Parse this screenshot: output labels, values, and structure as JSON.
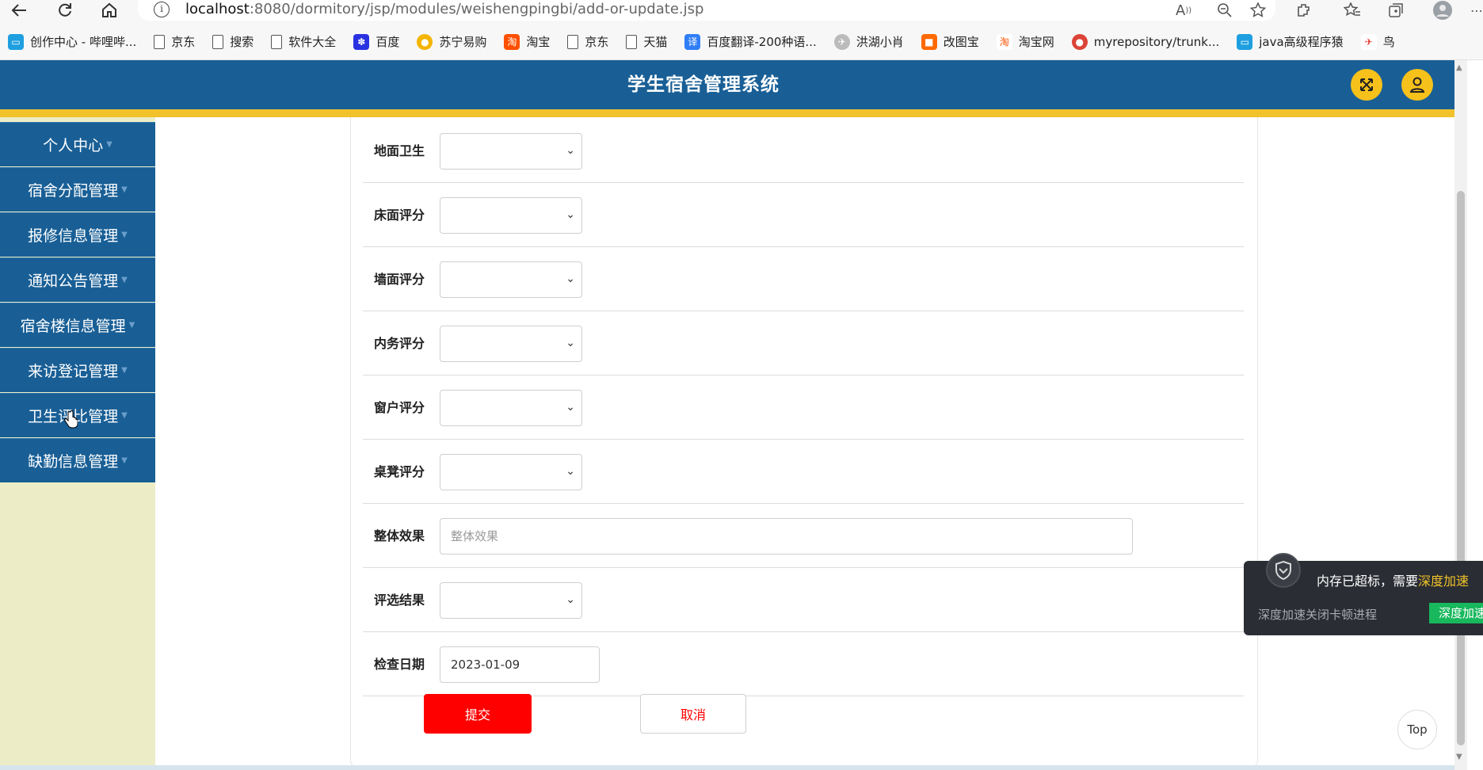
{
  "browser": {
    "url_host": "localhost",
    "url_path": ":8080/dormitory/jsp/modules/weishengpingbi/add-or-update.jsp",
    "bookmarks": [
      {
        "label": "创作中心 - 哔哩哔...",
        "icon": "bilibili-icon",
        "color": "#1e9fe0"
      },
      {
        "label": "京东",
        "icon": "page-icon"
      },
      {
        "label": "搜索",
        "icon": "page-icon"
      },
      {
        "label": "软件大全",
        "icon": "page-icon"
      },
      {
        "label": "百度",
        "icon": "baidu-icon",
        "color": "#2932e1"
      },
      {
        "label": "苏宁易购",
        "icon": "suning-icon",
        "color": "#f4b400"
      },
      {
        "label": "淘宝",
        "icon": "taobao-icon",
        "color": "#ff5000"
      },
      {
        "label": "京东",
        "icon": "page-icon"
      },
      {
        "label": "天猫",
        "icon": "page-icon"
      },
      {
        "label": "百度翻译-200种语...",
        "icon": "baidu-translate-icon",
        "color": "#2f7ef7"
      },
      {
        "label": "洪湖小肖",
        "icon": "bird-icon",
        "color": "#666666"
      },
      {
        "label": "改图宝",
        "icon": "gaitubao-icon",
        "color": "#ff6a00"
      },
      {
        "label": "淘宝网",
        "icon": "taobao-net-icon",
        "color": "#ff5000"
      },
      {
        "label": "myrepository/trunk...",
        "icon": "chrome-icon",
        "color": "#db4437"
      },
      {
        "label": "java高级程序猿",
        "icon": "bilibili-icon",
        "color": "#1e9fe0"
      },
      {
        "label": "鸟",
        "icon": "bird-red-icon",
        "color": "#e53935"
      }
    ]
  },
  "app": {
    "title": "学生宿舍管理系统"
  },
  "sidebar": {
    "items": [
      {
        "label": "个人中心"
      },
      {
        "label": "宿舍分配管理"
      },
      {
        "label": "报修信息管理"
      },
      {
        "label": "通知公告管理"
      },
      {
        "label": "宿舍楼信息管理"
      },
      {
        "label": "来访登记管理"
      },
      {
        "label": "卫生评比管理"
      },
      {
        "label": "缺勤信息管理"
      }
    ]
  },
  "form": {
    "fields": [
      {
        "label": "地面卫生",
        "type": "select",
        "value": ""
      },
      {
        "label": "床面评分",
        "type": "select",
        "value": ""
      },
      {
        "label": "墙面评分",
        "type": "select",
        "value": ""
      },
      {
        "label": "内务评分",
        "type": "select",
        "value": ""
      },
      {
        "label": "窗户评分",
        "type": "select",
        "value": ""
      },
      {
        "label": "桌凳评分",
        "type": "select",
        "value": ""
      },
      {
        "label": "整体效果",
        "type": "text",
        "value": "",
        "placeholder": "整体效果"
      },
      {
        "label": "评选结果",
        "type": "select",
        "value": ""
      },
      {
        "label": "检查日期",
        "type": "date",
        "value": "2023-01-09"
      }
    ],
    "submit_label": "提交",
    "cancel_label": "取消"
  },
  "toast": {
    "message_prefix": "内存已超标，需要",
    "message_highlight": "深度加速",
    "sub_text": "深度加速关闭卡顿进程",
    "action_label": "深度加速"
  },
  "top_button_label": "Top",
  "colors": {
    "header": "#195f96",
    "accent_yellow": "#f2c22a",
    "sidebar_bg": "#ecedc7",
    "submit_red": "#ff0000"
  }
}
